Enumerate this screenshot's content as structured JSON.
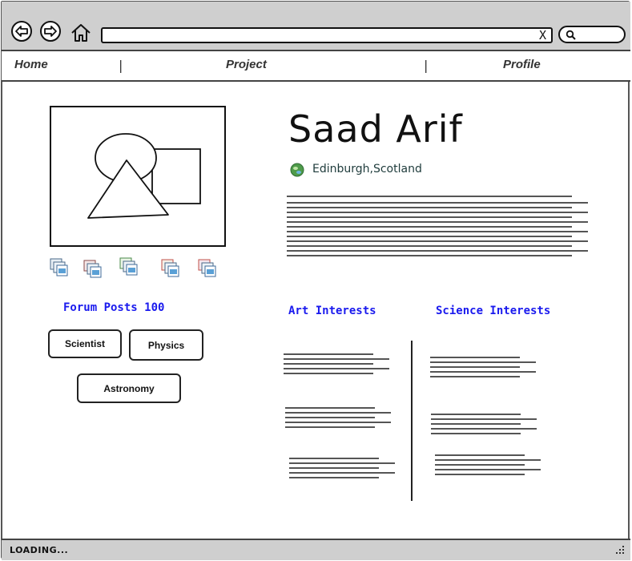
{
  "browser": {
    "url_clear_glyph": "X",
    "icons": [
      "back-icon",
      "forward-icon",
      "home-icon",
      "search-icon"
    ]
  },
  "nav": {
    "items": [
      {
        "label": "Home"
      },
      {
        "label": "Project"
      },
      {
        "label": "Profile"
      }
    ],
    "separator": "|"
  },
  "profile": {
    "name": "Saad Arif",
    "location": "Edinburgh,Scotland",
    "forum_posts": "Forum Posts 100",
    "tags": [
      "Scientist",
      "Physics",
      "Astronomy"
    ]
  },
  "sections": {
    "art_title": "Art Interests",
    "science_title": "Science Interests"
  },
  "status": {
    "text": "LOADING..."
  },
  "colors": {
    "chrome": "#cfcfcf",
    "link_blue": "#1a1aee",
    "line_gray": "#555555"
  }
}
